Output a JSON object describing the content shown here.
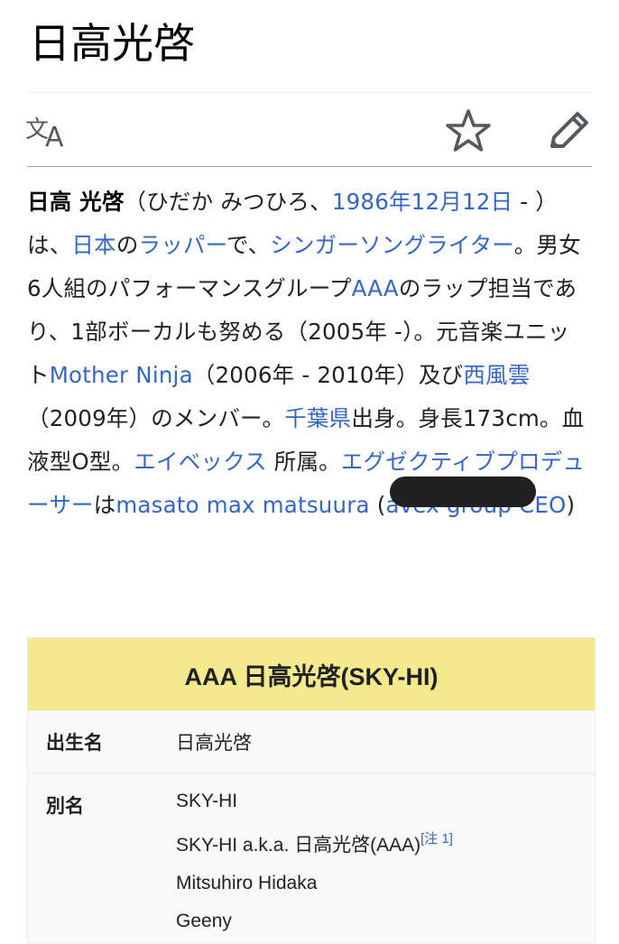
{
  "page": {
    "title": "日高光啓"
  },
  "toolbar": {
    "language_icon": "translate-icon",
    "watch_icon": "star-icon",
    "edit_icon": "pencil-icon"
  },
  "lead": {
    "subject": "日高 光啓",
    "reading_open": "（ひだか みつひろ、",
    "birth_date": "1986年12月12日",
    "t1": " - ）は、",
    "country": "日本",
    "t2": "の",
    "rapper": "ラッパー",
    "t3": "で、",
    "singer": "シンガーソングライター",
    "t4": "。男女6人組のパフォーマンスグループ",
    "group": "AAA",
    "t5": "のラップ担当であり、1部ボーカルも努める（2005年 -）。元音楽ユニット",
    "unit1": "Mother Ninja",
    "t6": "（2006年 - 2010年）及び",
    "unit2": "西風雲",
    "t7": "（2009年）のメンバー。",
    "pref": "千葉県",
    "t8": "出身。身長173cm。血液型O型。",
    "label": "エイベックス",
    "t9": " 所属。",
    "exec_producer": "エグゼクティブプロデューサー",
    "t10": "は",
    "ceo": "masato max matsuura",
    "t11": " (",
    "avex_ceo": "avex group CEO",
    "t12": ")"
  },
  "infobox": {
    "header": "AAA 日高光啓(SKY-HI)",
    "rows": [
      {
        "label": "出生名",
        "value": "日高光啓"
      },
      {
        "label": "別名",
        "values": [
          "SKY-HI",
          "SKY-HI a.k.a. 日高光啓(AAA)",
          "Mitsuhiro Hidaka",
          "Geeny"
        ]
      }
    ],
    "note_ref": "[注 1]"
  },
  "colors": {
    "link": "#3366cc",
    "infobox_header": "#f4e98c",
    "text": "#202122"
  }
}
